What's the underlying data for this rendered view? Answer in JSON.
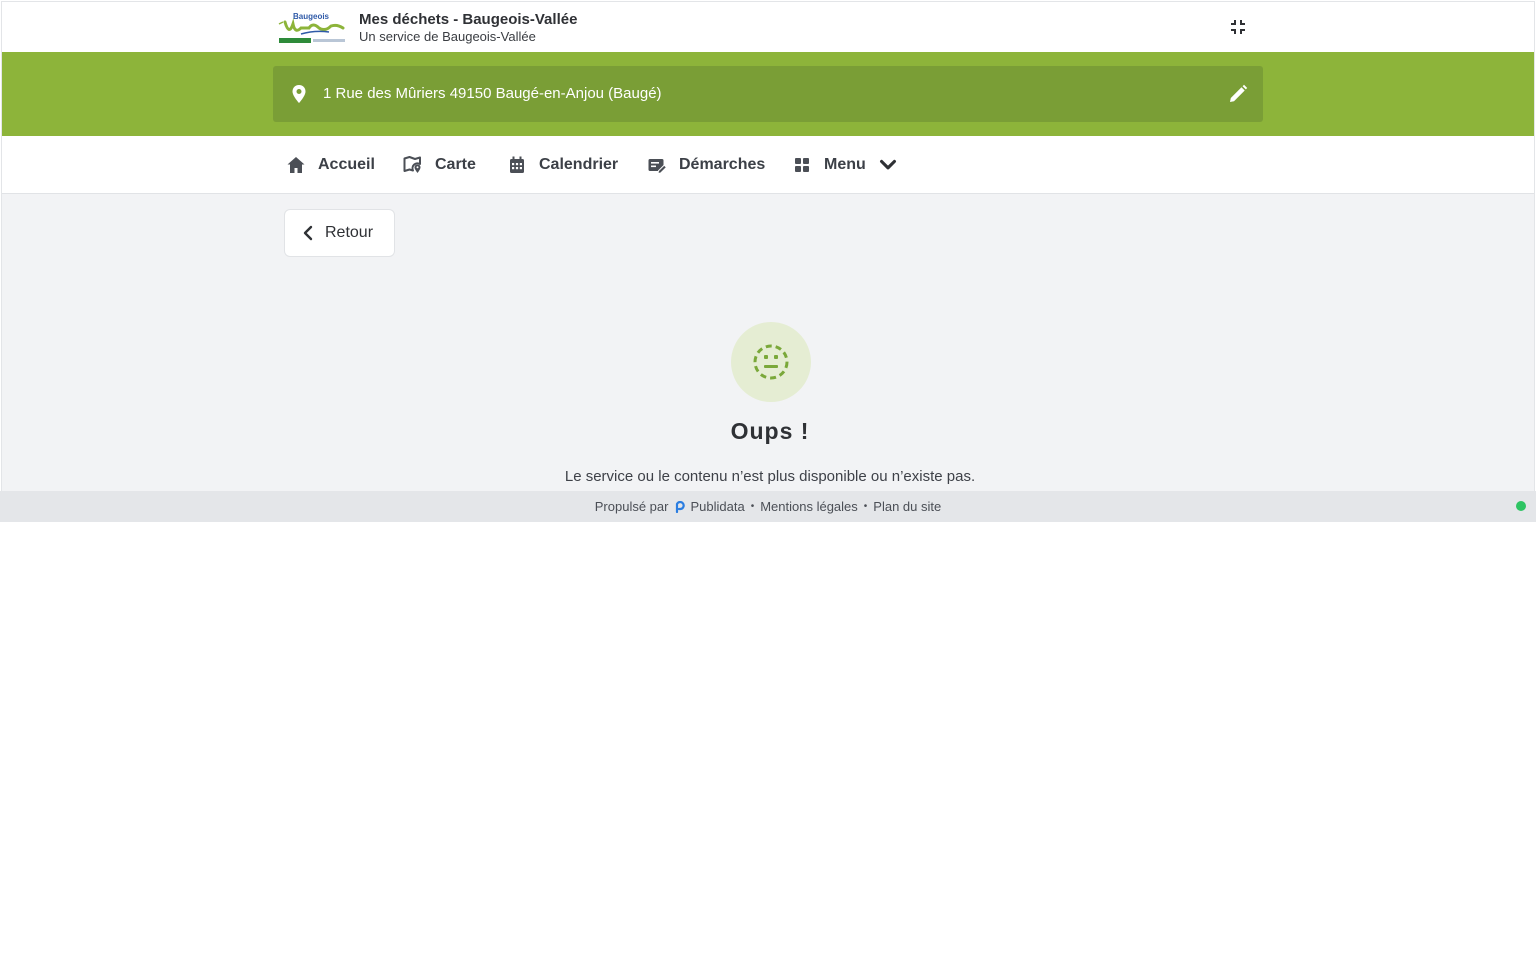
{
  "header": {
    "logo_text": "Baugeois Vallée",
    "title": "Mes déchets - Baugeois-Vallée",
    "subtitle": "Un service de Baugeois-Vallée"
  },
  "address": {
    "text": "1 Rue des Mûriers 49150 Baugé-en-Anjou (Baugé)"
  },
  "nav": {
    "items": [
      {
        "label": "Accueil",
        "icon": "home-icon"
      },
      {
        "label": "Carte",
        "icon": "map-icon"
      },
      {
        "label": "Calendrier",
        "icon": "calendar-icon"
      },
      {
        "label": "Démarches",
        "icon": "form-edit-icon"
      },
      {
        "label": "Menu",
        "icon": "grid-icon"
      }
    ]
  },
  "back": {
    "label": "Retour"
  },
  "error": {
    "title": "Oups !",
    "message": "Le service ou le contenu n’est plus disponible ou n’existe pas."
  },
  "footer": {
    "powered_by": "Propulsé par",
    "brand": "Publidata",
    "legal": "Mentions légales",
    "sitemap": "Plan du site"
  },
  "colors": {
    "brand_green": "#8db43a",
    "address_green": "#7a9e36",
    "status_online": "#2ec463"
  }
}
